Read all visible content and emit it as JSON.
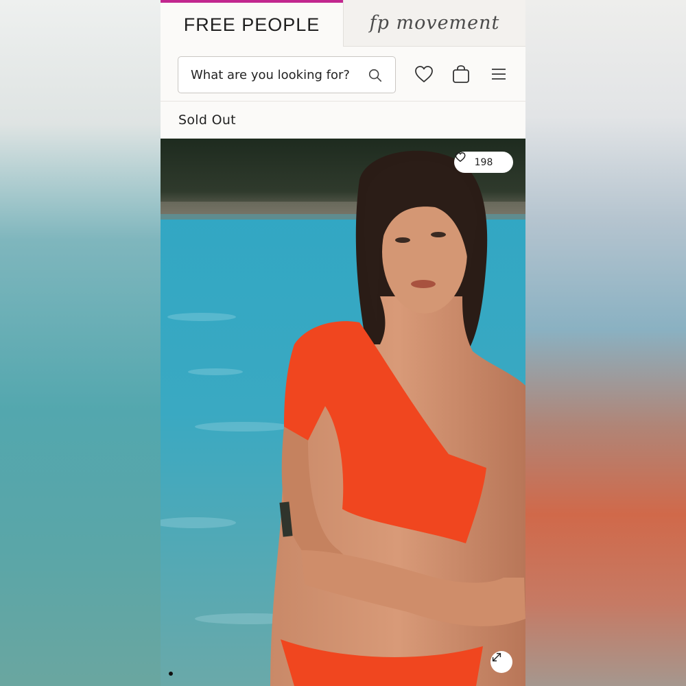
{
  "brand_tabs": [
    {
      "label": "FREE PEOPLE",
      "active": true
    },
    {
      "label": "fp movement",
      "active": false
    }
  ],
  "accent_color": "#c2278f",
  "search": {
    "placeholder": "What are you looking for?",
    "icon": "search-icon"
  },
  "header_icons": [
    "heart-icon",
    "bag-icon",
    "menu-icon"
  ],
  "status": {
    "label": "Sold Out"
  },
  "product": {
    "likes": "198",
    "image_controls": [
      "expand-icon"
    ],
    "carousel_dots": 1
  }
}
